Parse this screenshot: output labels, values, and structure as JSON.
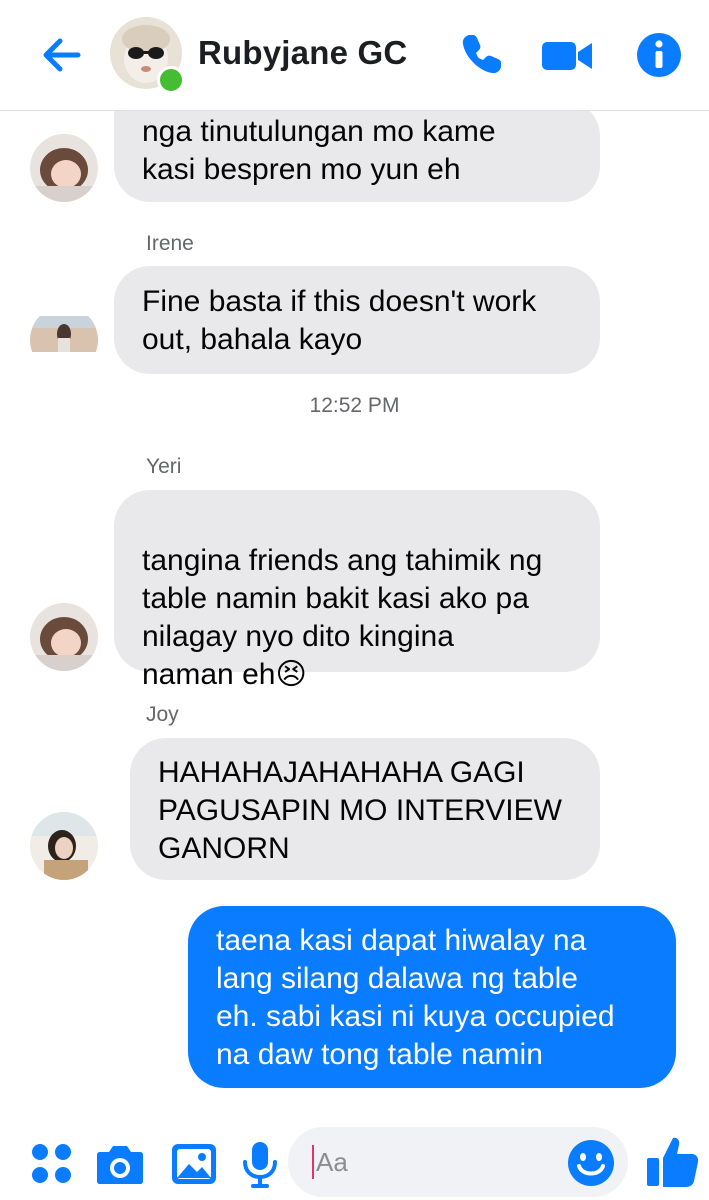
{
  "header": {
    "title": "Rubyjane GC",
    "icons": [
      "back-arrow-icon",
      "phone-icon",
      "video-camera-icon",
      "info-icon"
    ]
  },
  "messages": [
    {
      "sender": "",
      "text": "nga tinutulungan mo kame\nkasi bespren mo yun eh",
      "mine": false
    },
    {
      "sender": "Irene",
      "text": "Fine basta if this doesn't work\nout, bahala kayo",
      "mine": false
    },
    {
      "sender": "Yeri",
      "text": "tangina friends ang tahimik ng\ntable namin bakit kasi ako pa\nnilagay nyo dito kingina\nnaman eh",
      "emoji": "😣",
      "mine": false
    },
    {
      "sender": "Joy",
      "text": "HAHAHAJAHAHAHA GAGI\nPAGUSAPIN MO INTERVIEW\nGANORN",
      "mine": false
    },
    {
      "sender": "",
      "text": "taena kasi dapat hiwalay na\nlang silang dalawa ng table\neh. sabi kasi ni kuya occupied\nna daw tong table namin",
      "mine": true
    }
  ],
  "timestamp": "12:52 PM",
  "composer": {
    "placeholder": "Aa",
    "icons": [
      "menu-dots-icon",
      "camera-icon",
      "image-icon",
      "microphone-icon",
      "emoji-icon",
      "thumbs-up-icon"
    ]
  },
  "colors": {
    "accent": "#0a7cff",
    "received_bubble": "#e9e9eb",
    "online": "#44bd32"
  }
}
